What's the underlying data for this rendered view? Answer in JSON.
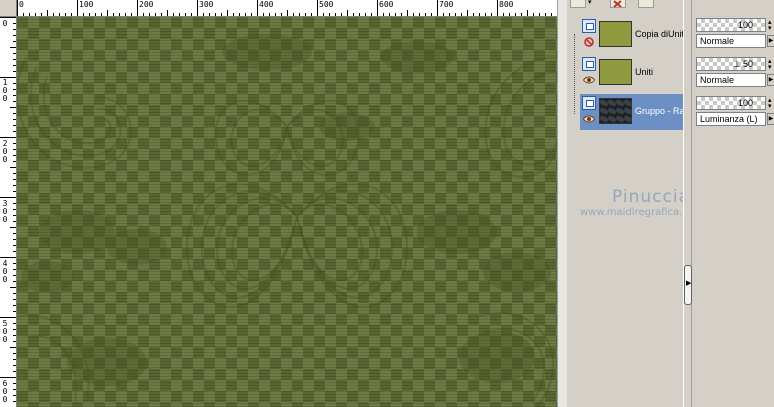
{
  "ruler": {
    "top_labels": [
      "0",
      "100",
      "200",
      "300",
      "400",
      "500",
      "600",
      "700",
      "800"
    ],
    "left_labels": [
      "0",
      "100",
      "200",
      "300",
      "400",
      "500",
      "600"
    ]
  },
  "layers": [
    {
      "name": "Copia diUniti",
      "visible_icon": "hidden-eye-icon",
      "thumbnail": "olive"
    },
    {
      "name": "Uniti",
      "visible_icon": "eye-icon",
      "thumbnail": "olive"
    },
    {
      "name": "Gruppo - Raster 1",
      "visible_icon": "eye-icon",
      "thumbnail": "dark",
      "selected": true
    }
  ],
  "properties": [
    {
      "opacity": "100",
      "blend_mode": "Normale"
    },
    {
      "opacity": "50",
      "blend_mode": "Normale"
    },
    {
      "opacity": "100",
      "blend_mode": "Luminanza (L)"
    }
  ],
  "watermark": {
    "name": "Pinuccia",
    "url": "www.maidiregrafica.eu"
  },
  "colors": {
    "canvas_olive": "#5d6a34",
    "selected_row": "#6d90c4",
    "watermark": "#93a7bd"
  }
}
